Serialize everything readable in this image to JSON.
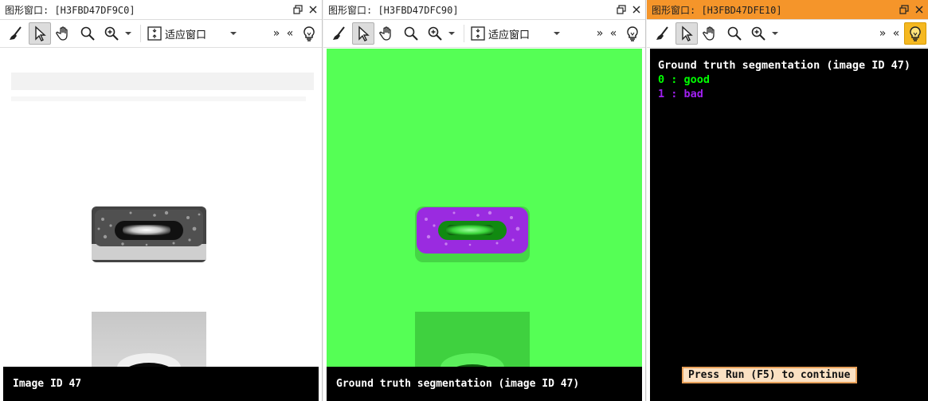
{
  "windows": [
    {
      "title": "图形窗口: [H3FBD47DF9C0]",
      "fit_label": "适应窗口",
      "caption": "Image ID 47"
    },
    {
      "title": "图形窗口: [H3FBD47DFC90]",
      "fit_label": "适应窗口",
      "caption": "Ground truth segmentation (image ID 47)"
    },
    {
      "title": "图形窗口: [H3FBD47DFE10]",
      "messages": {
        "heading": "Ground truth segmentation (image ID 47)",
        "line_good": "0 : good",
        "line_bad": "1 : bad"
      },
      "continue_button": "Press Run (F5) to continue"
    }
  ],
  "toolbar": {
    "expand_right": "»",
    "expand_left": "«"
  },
  "colors": {
    "good": "#00ff00",
    "bad": "#a020f0",
    "green_bg": "#55ff55",
    "active_title": "#f5952a"
  }
}
